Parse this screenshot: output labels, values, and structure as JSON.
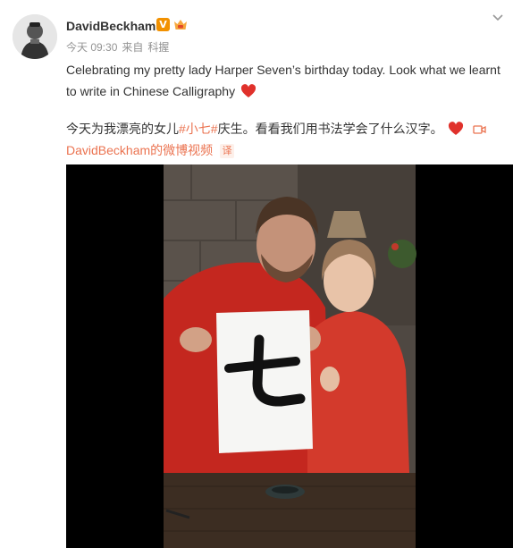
{
  "post": {
    "username": "DavidBeckham",
    "verified_badge": "V",
    "meta": {
      "time": "今天 09:30",
      "source_prefix": "来自",
      "source": "科握"
    },
    "text_en": "Celebrating my pretty lady Harper Seven’s birthday today. Look what we learnt to write in Chinese Calligraphy",
    "text_cn": {
      "before": "今天为我漂亮的女儿",
      "hashtag": "#小七#",
      "after": "庆生。看看我们用书法学会了什么汉字。"
    },
    "video_source": "DavidBeckham的微博视频",
    "translate_label": "译",
    "video": {
      "calligraphy_character": "七"
    }
  },
  "icons": {
    "avatar": "avatar-photo",
    "heart": "heart-icon",
    "video_link": "video-link-icon",
    "dropdown": "chevron-down-icon",
    "member": "member-crown-icon"
  },
  "colors": {
    "accent": "#eb7350",
    "verified": "#f29100",
    "heart": "#e0312b",
    "meta": "#939393",
    "text": "#333333"
  }
}
